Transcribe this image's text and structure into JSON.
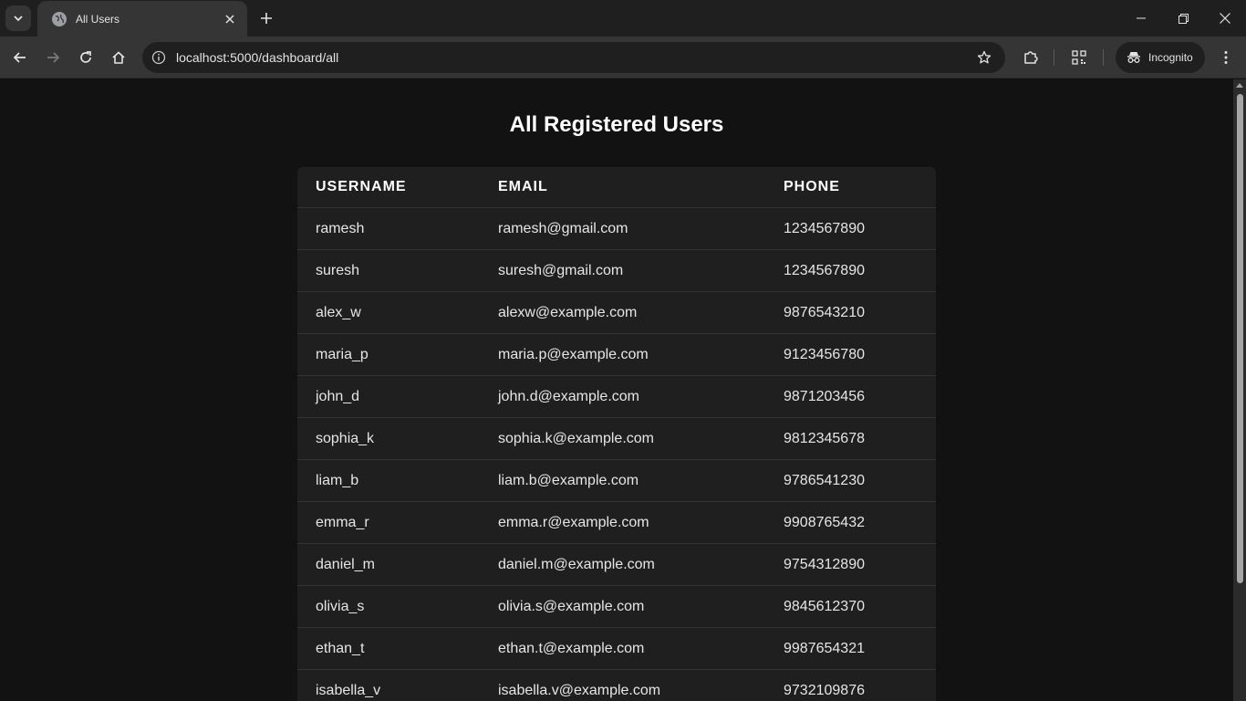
{
  "browser": {
    "tab_title": "All Users",
    "url": "localhost:5000/dashboard/all",
    "incognito_label": "Incognito"
  },
  "page": {
    "title": "All Registered Users"
  },
  "table": {
    "headers": [
      "USERNAME",
      "EMAIL",
      "PHONE"
    ],
    "rows": [
      [
        "ramesh",
        "ramesh@gmail.com",
        "1234567890"
      ],
      [
        "suresh",
        "suresh@gmail.com",
        "1234567890"
      ],
      [
        "alex_w",
        "alexw@example.com",
        "9876543210"
      ],
      [
        "maria_p",
        "maria.p@example.com",
        "9123456780"
      ],
      [
        "john_d",
        "john.d@example.com",
        "9871203456"
      ],
      [
        "sophia_k",
        "sophia.k@example.com",
        "9812345678"
      ],
      [
        "liam_b",
        "liam.b@example.com",
        "9786541230"
      ],
      [
        "emma_r",
        "emma.r@example.com",
        "9908765432"
      ],
      [
        "daniel_m",
        "daniel.m@example.com",
        "9754312890"
      ],
      [
        "olivia_s",
        "olivia.s@example.com",
        "9845612370"
      ],
      [
        "ethan_t",
        "ethan.t@example.com",
        "9987654321"
      ],
      [
        "isabella_v",
        "isabella.v@example.com",
        "9732109876"
      ]
    ]
  }
}
